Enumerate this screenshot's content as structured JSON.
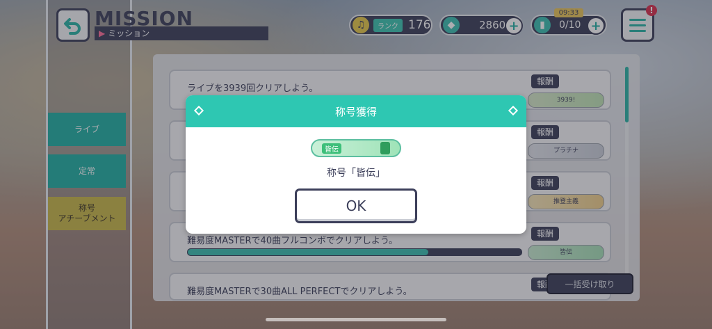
{
  "header": {
    "title": "MISSION",
    "subtitle": "ミッション",
    "rank_label": "ランク",
    "rank_value": "176",
    "gems": "2860",
    "energy": "0/10",
    "timer": "09:33",
    "notification": "!"
  },
  "sidebar": {
    "items": [
      {
        "label": "ライブ"
      },
      {
        "label": "定常"
      },
      {
        "label": "称号\nアチーブメント"
      }
    ]
  },
  "missions": [
    {
      "text": "ライブを3939回クリアしよう。",
      "reward_label": "報酬",
      "reward": "3939!"
    },
    {
      "text": "",
      "reward_label": "報酬",
      "reward": "プラチナ"
    },
    {
      "text": "",
      "reward_label": "報酬",
      "reward": "推登主義"
    },
    {
      "text": "難易度MASTERで40曲フルコンボでクリアしよう。",
      "reward_label": "報酬",
      "reward": "皆伝",
      "progress": 0.72
    },
    {
      "text": "難易度MASTERで30曲ALL PERFECTでクリアしよう。",
      "reward_label": "報酬"
    }
  ],
  "bulk_button": "一括受け取り",
  "modal": {
    "title": "称号獲得",
    "badge_text": "皆伝",
    "message": "称号「皆伝」",
    "ok_label": "OK"
  },
  "colors": {
    "accent": "#2ec7b2",
    "dark": "#3c3f5a",
    "alert": "#d9304c"
  }
}
